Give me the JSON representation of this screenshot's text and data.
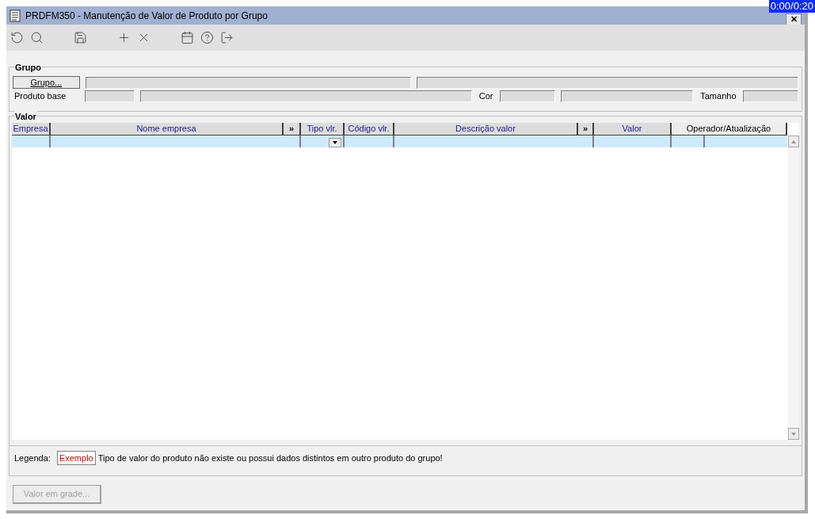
{
  "window": {
    "title": "PRDFM350 - Manutenção de Valor de Produto por Grupo",
    "close": "✕"
  },
  "overlay": {
    "timer": "0:00/0:20"
  },
  "toolbar": [
    {
      "kind": "undo"
    },
    {
      "kind": "search"
    },
    {
      "kind": "gap"
    },
    {
      "kind": "save"
    },
    {
      "kind": "gap"
    },
    {
      "kind": "add"
    },
    {
      "kind": "delete"
    },
    {
      "kind": "gap"
    },
    {
      "kind": "calendar"
    },
    {
      "kind": "help"
    },
    {
      "kind": "exit"
    }
  ],
  "grupo": {
    "title": "Grupo",
    "button": "Grupo...",
    "product_label": "Produto base",
    "color_label": "Cor",
    "size_label": "Tamanho"
  },
  "valor": {
    "title": "Valor",
    "columns": [
      {
        "label": "Empresa",
        "kind": "field"
      },
      {
        "label": "Nome empresa",
        "kind": "field"
      },
      {
        "label": "»",
        "kind": "expander"
      },
      {
        "label": "Tipo vlr.",
        "kind": "dropdown"
      },
      {
        "label": "Código vlr.",
        "kind": "field"
      },
      {
        "label": "Descrição valor",
        "kind": "field"
      },
      {
        "label": "»",
        "kind": "expander"
      },
      {
        "label": "Valor",
        "kind": "field"
      },
      {
        "label": "Operador/Atualização",
        "kind": "split"
      }
    ],
    "rows": [
      {
        "selected": true
      }
    ],
    "legend": {
      "label": "Legenda:",
      "sample": "Exemplo",
      "text": "Tipo de valor do produto não existe ou possui dados distintos em outro produto do grupo!"
    }
  },
  "footer_button": {
    "label": "Valor em grade...",
    "disabled": true
  }
}
